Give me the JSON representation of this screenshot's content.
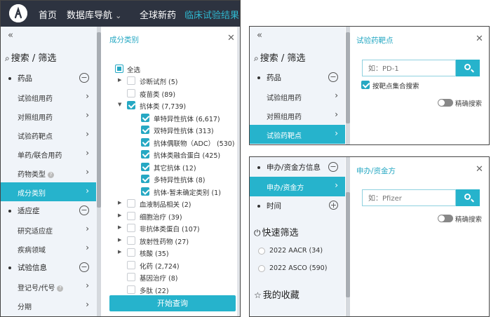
{
  "topnav": {
    "items": [
      "首页",
      "数据库导航",
      "全球新药",
      "临床试验结果"
    ],
    "dropdown_arrow": "⌄"
  },
  "sidebar": {
    "collapse": "«",
    "search_title": "搜索 / 筛选",
    "groups": [
      {
        "label": "药品",
        "toggle": "−",
        "items": [
          {
            "label": "试验组用药"
          },
          {
            "label": "对照组用药"
          },
          {
            "label": "试验药靶点"
          },
          {
            "label": "单药/联合用药"
          },
          {
            "label": "药物类型",
            "help": true
          },
          {
            "label": "成分类别",
            "active": true
          }
        ]
      },
      {
        "label": "适应症",
        "toggle": "−",
        "items": [
          {
            "label": "研究适应症"
          },
          {
            "label": "疾病领域"
          }
        ]
      },
      {
        "label": "试验信息",
        "toggle": "−",
        "items": [
          {
            "label": "登记号/代号",
            "help": true
          },
          {
            "label": "分期"
          }
        ]
      }
    ]
  },
  "category_panel": {
    "title": "成分类别",
    "select_all": "全选",
    "rows": [
      {
        "label": "诊断试剂 (5)",
        "level": 1,
        "caret": "▶",
        "state": "off"
      },
      {
        "label": "疫苗类 (89)",
        "level": 1,
        "caret": "",
        "state": "off"
      },
      {
        "label": "抗体类 (7,739)",
        "level": 1,
        "caret": "▼",
        "state": "on"
      },
      {
        "label": "单特异性抗体 (6,617)",
        "level": 2,
        "state": "on"
      },
      {
        "label": "双特异性抗体 (313)",
        "level": 2,
        "state": "on"
      },
      {
        "label": "抗体偶联物（ADC） (530)",
        "level": 2,
        "state": "on"
      },
      {
        "label": "抗体类融合蛋白 (425)",
        "level": 2,
        "state": "on"
      },
      {
        "label": "其它抗体 (12)",
        "level": 2,
        "state": "on"
      },
      {
        "label": "多特异性抗体 (8)",
        "level": 2,
        "state": "on"
      },
      {
        "label": "抗体-暂未确定类别 (1)",
        "level": 2,
        "state": "on"
      },
      {
        "label": "血液制品相关 (2)",
        "level": 1,
        "caret": "▶",
        "state": "off"
      },
      {
        "label": "细胞治疗 (39)",
        "level": 1,
        "caret": "▶",
        "state": "off"
      },
      {
        "label": "非抗体类蛋白 (107)",
        "level": 1,
        "caret": "▶",
        "state": "off"
      },
      {
        "label": "放射性药物 (27)",
        "level": 1,
        "caret": "▶",
        "state": "off"
      },
      {
        "label": "核酸 (35)",
        "level": 1,
        "caret": "▶",
        "state": "off"
      },
      {
        "label": "化药 (2,724)",
        "level": 1,
        "caret": "",
        "state": "off"
      },
      {
        "label": "基因治疗 (8)",
        "level": 1,
        "caret": "",
        "state": "off"
      },
      {
        "label": "多肽 (22)",
        "level": 1,
        "caret": "",
        "state": "off"
      }
    ],
    "submit": "开始查询"
  },
  "target_window": {
    "collapse": "«",
    "search_title": "搜索 / 筛选",
    "group": "药品",
    "items": [
      "试验组用药",
      "对照组用药",
      "试验药靶点"
    ],
    "panel_title": "试验药靶点",
    "placeholder": "如：PD-1",
    "checkbox_label": "按靶点集合搜索",
    "precise": "精确搜索"
  },
  "sponsor_window": {
    "group": "申办/资金方信息",
    "active_item": "申办/资金方",
    "time": "时间",
    "quick_title": "快速筛选",
    "quick_items": [
      "2022 AACR  (34)",
      "2022 ASCO  (590)"
    ],
    "fav_title": "我的收藏",
    "panel_title": "申办/资金方",
    "placeholder": "如：Pfizer",
    "precise": "精确搜索"
  }
}
